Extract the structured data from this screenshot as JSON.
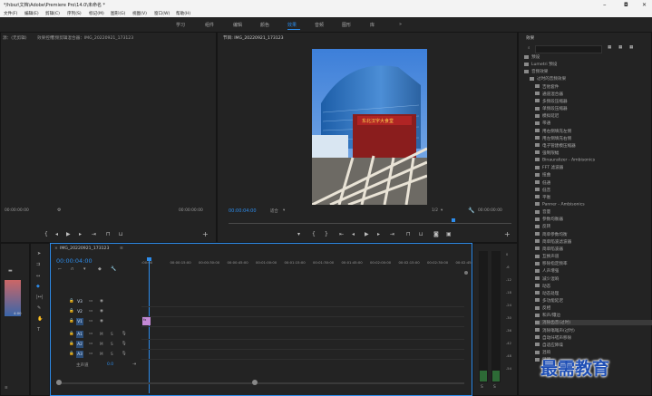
{
  "titlebar": {
    "title": "*/hbsz\\文档\\Adobe\\Premiere Pro\\14.0\\未命名 *",
    "minimize": "–",
    "maximize": "◘",
    "close": "✕"
  },
  "menu": [
    "文件(F)",
    "编辑(E)",
    "剪辑(C)",
    "序列(S)",
    "标记(M)",
    "图形(G)",
    "视图(V)",
    "窗口(W)",
    "帮助(H)"
  ],
  "workspaces": {
    "items": [
      "学习",
      "组件",
      "编辑",
      "颜色",
      "效果",
      "音频",
      "图形",
      "库"
    ],
    "active": "效果",
    "more": "»"
  },
  "source": {
    "tab1": "源：(无剪辑)",
    "tab2": "效果控件",
    "tab3": "音频剪辑混合器：IMG_20220921_173123",
    "timecode_left": "00:00:00:00",
    "timecode_right": "00:00:00:00"
  },
  "program": {
    "tab": "节目: IMG_20220921_173123",
    "timecode": "00:00:04:00",
    "fit": "适合",
    "quality": "1/2",
    "duration": "00:00:00:00",
    "photo_sign": "东北汉字大食堂"
  },
  "project": {
    "tab": "效果",
    "search_placeholder": "",
    "items": [
      {
        "name": "预设",
        "indent": 0
      },
      {
        "name": "Lumetri 预设",
        "indent": 0
      },
      {
        "name": "音频效果",
        "indent": 0
      },
      {
        "name": "过时的音频效果",
        "indent": 1
      },
      {
        "name": "吉他套件",
        "indent": 2
      },
      {
        "name": "通道混合器",
        "indent": 2
      },
      {
        "name": "多频段压缩器",
        "indent": 2
      },
      {
        "name": "单频段压缩器",
        "indent": 2
      },
      {
        "name": "模拟延迟",
        "indent": 2
      },
      {
        "name": "带通",
        "indent": 2
      },
      {
        "name": "用右侧填充左侧",
        "indent": 2
      },
      {
        "name": "用左侧填充右侧",
        "indent": 2
      },
      {
        "name": "电子管建模压缩器",
        "indent": 2
      },
      {
        "name": "强制限幅",
        "indent": 2
      },
      {
        "name": "Binauralizer - Ambisonics",
        "indent": 2
      },
      {
        "name": "FFT 滤波器",
        "indent": 2
      },
      {
        "name": "扭曲",
        "indent": 2
      },
      {
        "name": "低通",
        "indent": 2
      },
      {
        "name": "低音",
        "indent": 2
      },
      {
        "name": "平衡",
        "indent": 2
      },
      {
        "name": "Panner - Ambisonics",
        "indent": 2
      },
      {
        "name": "音量",
        "indent": 2
      },
      {
        "name": "参数均衡器",
        "indent": 2
      },
      {
        "name": "反转",
        "indent": 2
      },
      {
        "name": "简单参数均衡",
        "indent": 2
      },
      {
        "name": "简单陷波滤波器",
        "indent": 2
      },
      {
        "name": "简单陷波器",
        "indent": 2
      },
      {
        "name": "互换声道",
        "indent": 2
      },
      {
        "name": "移除指定频率",
        "indent": 2
      },
      {
        "name": "人声增强",
        "indent": 2
      },
      {
        "name": "减少混响",
        "indent": 2
      },
      {
        "name": "动态",
        "indent": 2
      },
      {
        "name": "动态处理",
        "indent": 2
      },
      {
        "name": "多功能延迟",
        "indent": 2
      },
      {
        "name": "反相",
        "indent": 2
      },
      {
        "name": "和声/镶边",
        "indent": 2
      },
      {
        "name": "消除齿音(过时)",
        "indent": 2
      },
      {
        "name": "消除嗡嗡声(过时)",
        "indent": 2
      },
      {
        "name": "自动咔嗒声移除",
        "indent": 2
      },
      {
        "name": "自适应降噪",
        "indent": 2
      },
      {
        "name": "混响",
        "indent": 2
      },
      {
        "name": "延迟",
        "indent": 2
      }
    ]
  },
  "timeline": {
    "tab": "IMG_20220921_173123",
    "timecode": "00:00:04:00",
    "ruler": [
      ":00:00",
      "00:00:15:00",
      "00:00:30:00",
      "00:00:45:00",
      "00:01:00:00",
      "00:01:15:00",
      "00:01:30:00",
      "00:01:45:00",
      "00:02:00:00",
      "00:02:15:00",
      "00:02:30:00",
      "00:02:45:"
    ],
    "video_tracks": [
      "V3",
      "V2",
      "V1"
    ],
    "audio_tracks": [
      "A1",
      "A2",
      "A3"
    ],
    "master_label": "主声道",
    "master_value": "0.0",
    "track_buttons": {
      "m": "M",
      "s": "S"
    },
    "clip_label": "fx"
  },
  "left_panel": {
    "thumb_label": "4:00"
  },
  "meters": {
    "labels": [
      "0",
      "-6",
      "-12",
      "-18",
      "-24",
      "-30",
      "-36",
      "-42",
      "-48",
      "-54"
    ],
    "bottom": [
      "S",
      "S"
    ]
  },
  "watermark": "最需教育"
}
